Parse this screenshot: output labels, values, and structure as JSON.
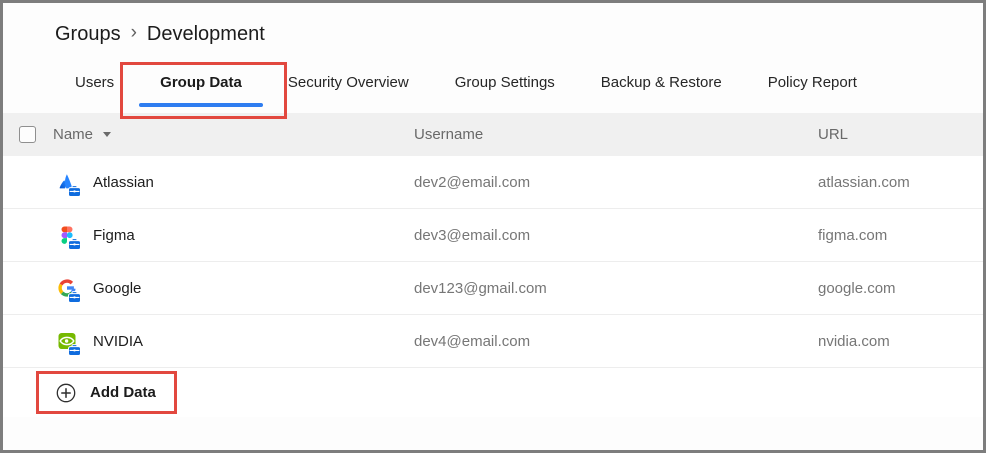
{
  "breadcrumb": {
    "root": "Groups",
    "separator": "›",
    "current": "Development"
  },
  "tabs": [
    {
      "label": "Users",
      "selected": false
    },
    {
      "label": "Group Data",
      "selected": true,
      "annotated": true
    },
    {
      "label": "Security Overview",
      "selected": false
    },
    {
      "label": "Group Settings",
      "selected": false
    },
    {
      "label": "Backup & Restore",
      "selected": false
    },
    {
      "label": "Policy Report",
      "selected": false
    }
  ],
  "table": {
    "columns": {
      "name": "Name",
      "username": "Username",
      "url": "URL"
    },
    "rows": [
      {
        "name": "Atlassian",
        "username": "dev2@email.com",
        "url": "atlassian.com",
        "icon": "atlassian-favicon"
      },
      {
        "name": "Figma",
        "username": "dev3@email.com",
        "url": "figma.com",
        "icon": "figma-favicon"
      },
      {
        "name": "Google",
        "username": "dev123@gmail.com",
        "url": "google.com",
        "icon": "google-favicon"
      },
      {
        "name": "NVIDIA",
        "username": "dev4@email.com",
        "url": "nvidia.com",
        "icon": "nvidia-favicon"
      }
    ]
  },
  "add_button": {
    "label": "Add Data"
  },
  "icons": {
    "sort": "caret-down-icon",
    "add": "plus-circle-icon",
    "favicon_overlay": "briefcase-badge-icon"
  },
  "colors": {
    "accent_blue": "#2e7df0",
    "annotation_red": "#e2483f",
    "badge_blue": "#0f6cde",
    "header_bg": "#f0f0f0"
  }
}
